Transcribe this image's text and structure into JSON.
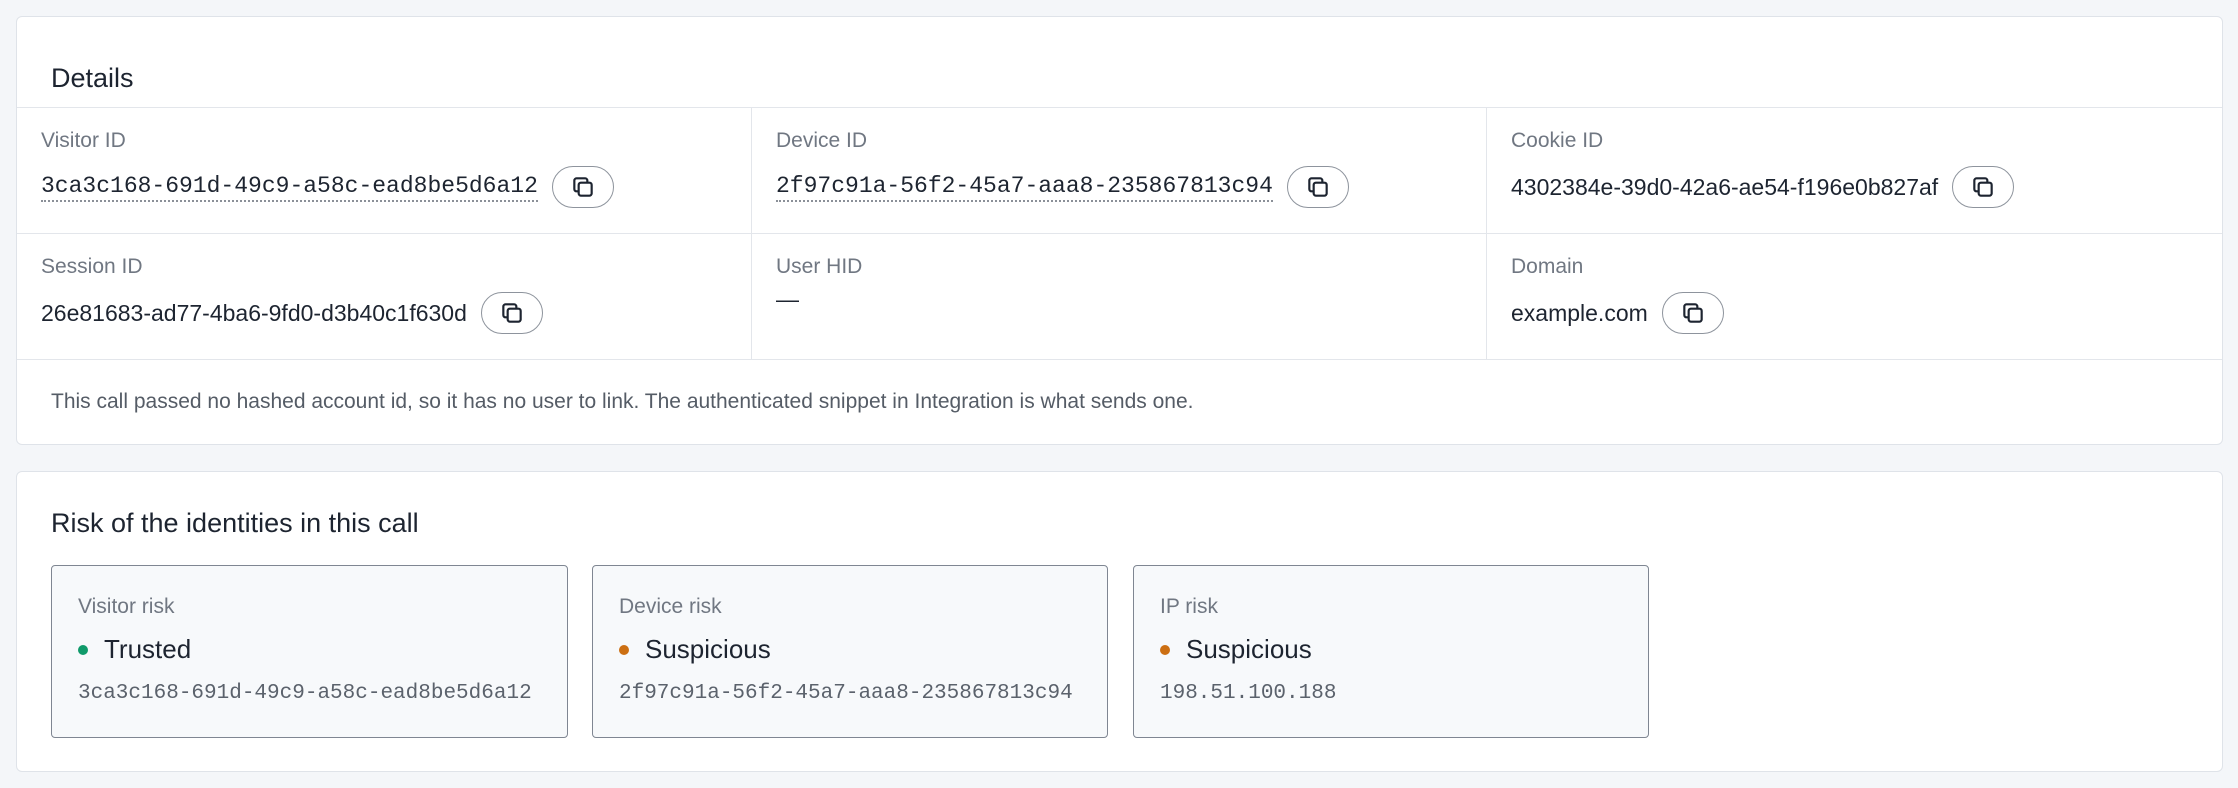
{
  "details": {
    "title": "Details",
    "fields": {
      "visitor_id": {
        "label": "Visitor ID",
        "value": "3ca3c168-691d-49c9-a58c-ead8be5d6a12"
      },
      "device_id": {
        "label": "Device ID",
        "value": "2f97c91a-56f2-45a7-aaa8-235867813c94"
      },
      "cookie_id": {
        "label": "Cookie ID",
        "value": "4302384e-39d0-42a6-ae54-f196e0b827af"
      },
      "session_id": {
        "label": "Session ID",
        "value": "26e81683-ad77-4ba6-9fd0-d3b40c1f630d"
      },
      "user_hid": {
        "label": "User HID",
        "value": "—"
      },
      "domain": {
        "label": "Domain",
        "value": "example.com"
      }
    },
    "note": "This call passed no hashed account id, so it has no user to link. The authenticated snippet in Integration is what sends one."
  },
  "risk": {
    "title": "Risk of the identities in this call",
    "items": [
      {
        "label": "Visitor risk",
        "status": "Trusted",
        "status_color": "#0f9a6a",
        "id": "3ca3c168-691d-49c9-a58c-ead8be5d6a12"
      },
      {
        "label": "Device risk",
        "status": "Suspicious",
        "status_color": "#cc6f12",
        "id": "2f97c91a-56f2-45a7-aaa8-235867813c94"
      },
      {
        "label": "IP risk",
        "status": "Suspicious",
        "status_color": "#cc6f12",
        "id": "198.51.100.188"
      }
    ]
  },
  "icons": {
    "copy": "copy-icon"
  }
}
